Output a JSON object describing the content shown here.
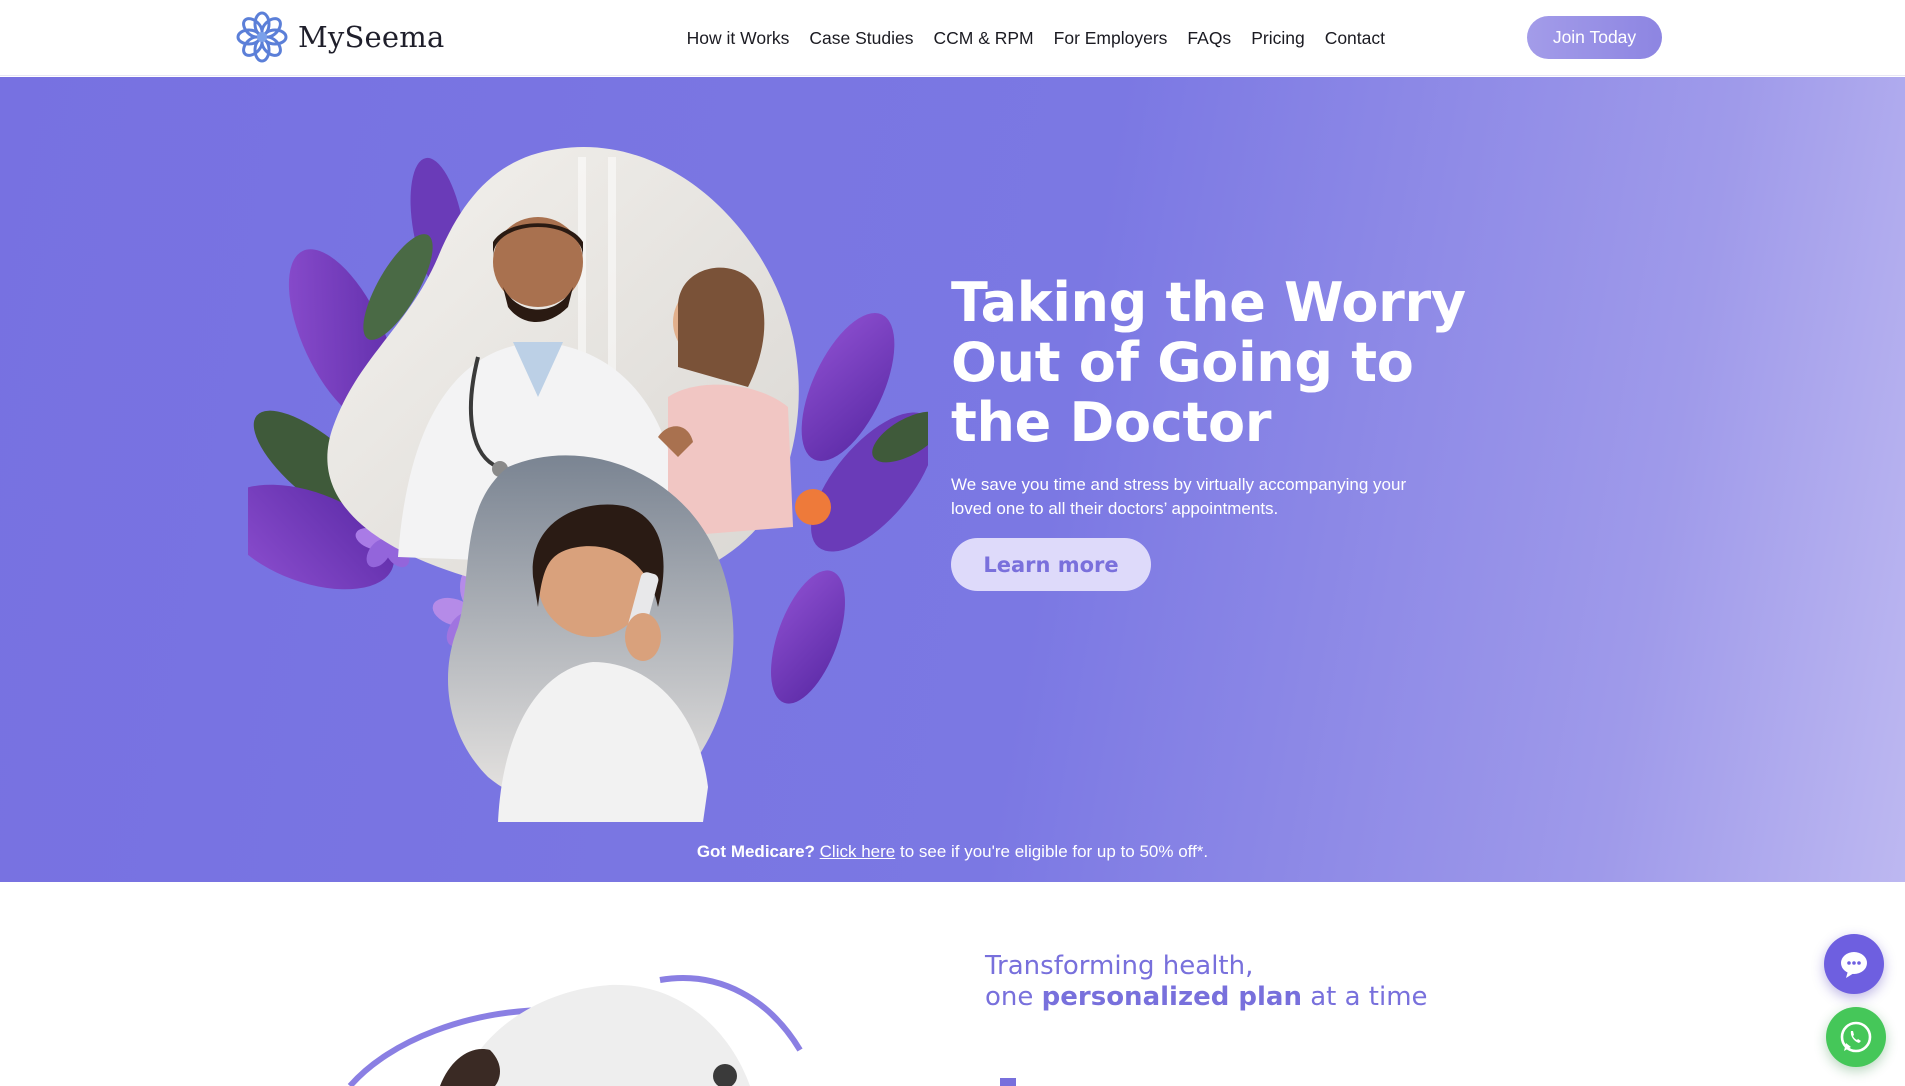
{
  "header": {
    "logo_text": "MySeema",
    "logo_icon": "flower-logo-icon",
    "nav": [
      {
        "label": "How it Works"
      },
      {
        "label": "Case Studies"
      },
      {
        "label": "CCM & RPM"
      },
      {
        "label": "For Employers"
      },
      {
        "label": "FAQs"
      },
      {
        "label": "Pricing"
      },
      {
        "label": "Contact"
      }
    ],
    "cta_label": "Join Today"
  },
  "hero": {
    "title_lines": [
      "Taking the Worry",
      "Out of Going to",
      "the Doctor"
    ],
    "subtitle": "We save you time and stress by virtually accompanying your loved one to all their doctors’ appointments.",
    "button_label": "Learn more",
    "medicare_bold": "Got Medicare?",
    "medicare_link": "Click here",
    "medicare_rest": " to see if you're eligible for up to 50% off*."
  },
  "section2": {
    "tagline_line1": "Transforming health,",
    "tagline_pre": "one ",
    "tagline_bold": "personalized plan",
    "tagline_post": " at a time"
  },
  "widgets": {
    "chat_icon": "chat-bubble-icon",
    "whatsapp_icon": "whatsapp-icon"
  },
  "colors": {
    "brand_purple": "#7870dc",
    "hero_bg_start": "#7771e1",
    "hero_bg_end": "#bdb8f1",
    "join_button": "#9c94e6",
    "learn_button_bg": "#dedafa",
    "chat_widget": "#6e5fe0",
    "whatsapp_green": "#45c759"
  }
}
